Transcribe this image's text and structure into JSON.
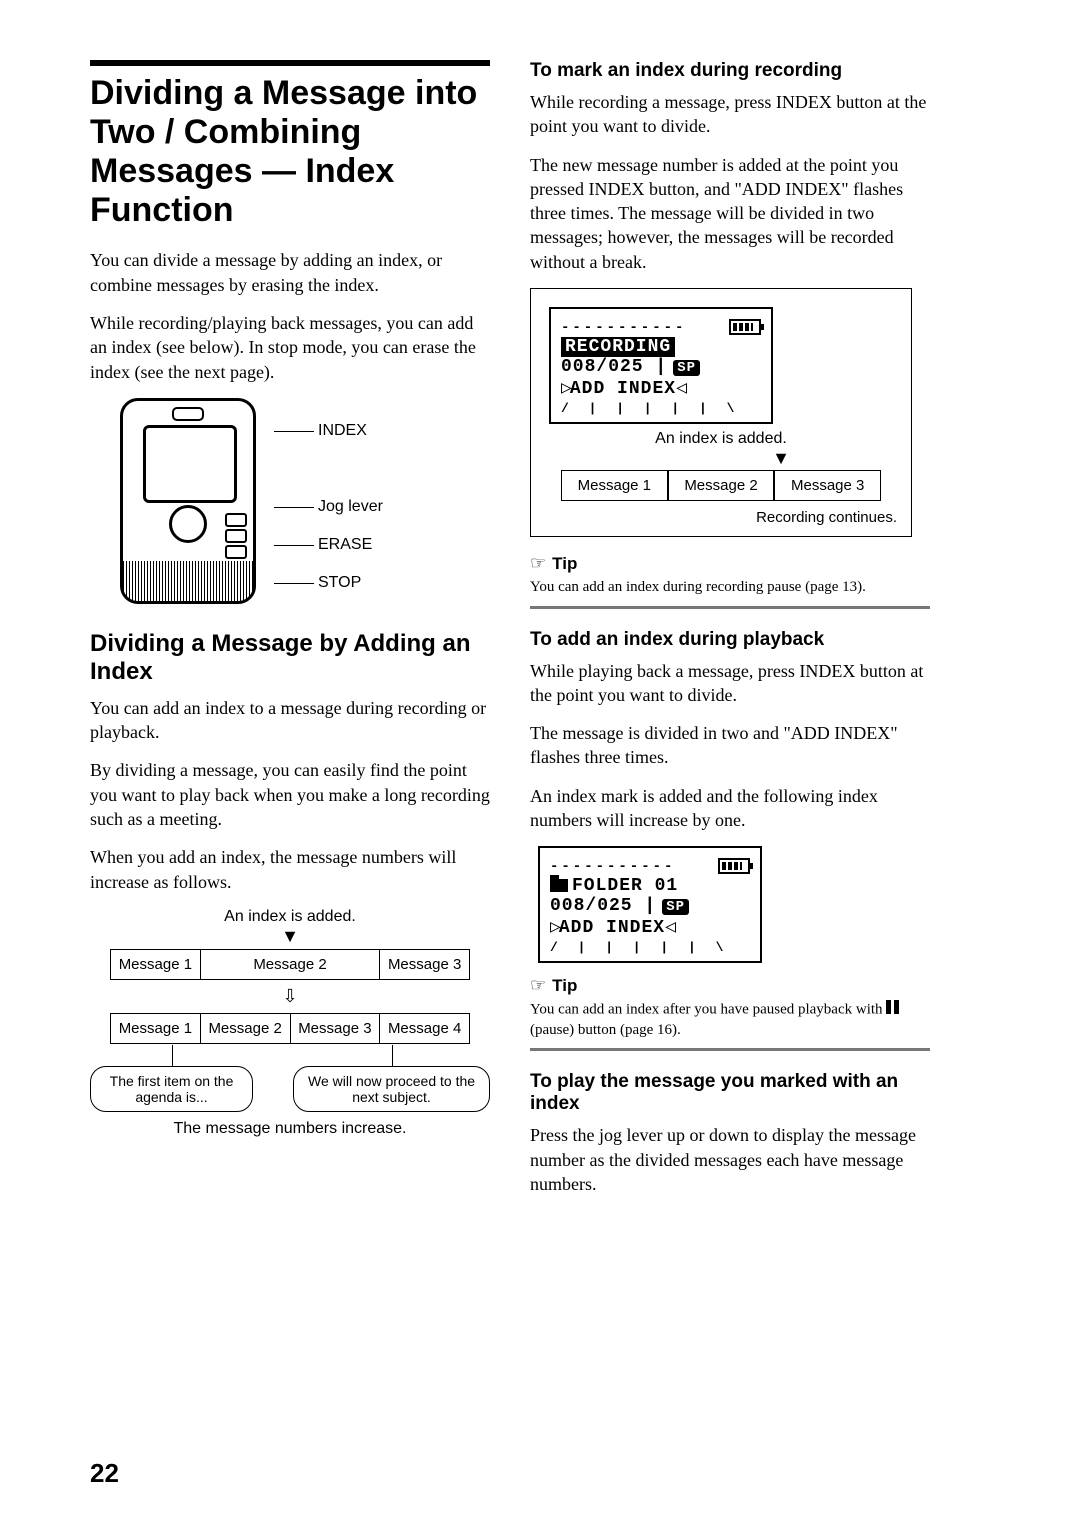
{
  "page_number": "22",
  "title": "Dividing a Message into Two / Combining Messages — Index Function",
  "intro_p1": "You can divide a message by adding an index, or combine messages by erasing the index.",
  "intro_p2": "While recording/playing back messages, you can add an index (see below).  In stop mode, you can erase the index (see the next page).",
  "device_labels": {
    "index": "INDEX",
    "jog": "Jog lever",
    "erase": "ERASE",
    "stop": "STOP"
  },
  "section2_title": "Dividing a Message by Adding an Index",
  "section2_p1": "You can add an index to a message during recording or playback.",
  "section2_p2": "By dividing a message, you can easily find the point you want to play back when you make a long recording such as a meeting.",
  "section2_p3": "When you add an index, the message numbers will increase as follows.",
  "diagram_left": {
    "caption_top": "An index is added.",
    "row1": [
      "Message 1",
      "Message 2",
      "Message 3"
    ],
    "row2": [
      "Message 1",
      "Message 2",
      "Message 3",
      "Message 4"
    ],
    "callout1": "The first item on the agenda is...",
    "callout2": "We will now proceed to the next subject.",
    "caption_bottom": "The message numbers increase."
  },
  "right": {
    "h_rec": "To mark an index during recording",
    "rec_p1": "While recording a message, press INDEX button at the point you want to divide.",
    "rec_p2": "The new message number is added at the point you pressed INDEX button, and \"ADD INDEX\" flashes three times. The message will be divided in two messages; however, the messages will be recorded without a break.",
    "lcd_rec": {
      "dashes": "-----------",
      "line1": "RECORDING",
      "line2_a": "008/025",
      "line2_sp": "SP",
      "line3": "ADD INDEX"
    },
    "index_added": "An index is added.",
    "row": [
      "Message 1",
      "Message 2",
      "Message 3"
    ],
    "rec_continues": "Recording continues.",
    "tip_label": "Tip",
    "tip1_text": "You can add an index during recording pause (page 13).",
    "h_play": "To add an index during playback",
    "play_p1": "While playing back a message, press INDEX button at the point you want to divide.",
    "play_p2": "The message is divided in two and \"ADD INDEX\" flashes three times.",
    "play_p3": "An index mark is added and the following index numbers will increase by one.",
    "lcd_play": {
      "dashes": "-----------",
      "line1": "FOLDER 01",
      "line2_a": "008/025",
      "line2_sp": "SP",
      "line3": "ADD INDEX"
    },
    "tip2_text_a": "You can add an index after you have paused playback with ",
    "tip2_text_b": "(pause) button (page 16).",
    "h_playmsg": "To play the message you marked with an index",
    "playmsg_p1": "Press the jog lever up or down to display the message number as the divided messages each have message numbers."
  }
}
